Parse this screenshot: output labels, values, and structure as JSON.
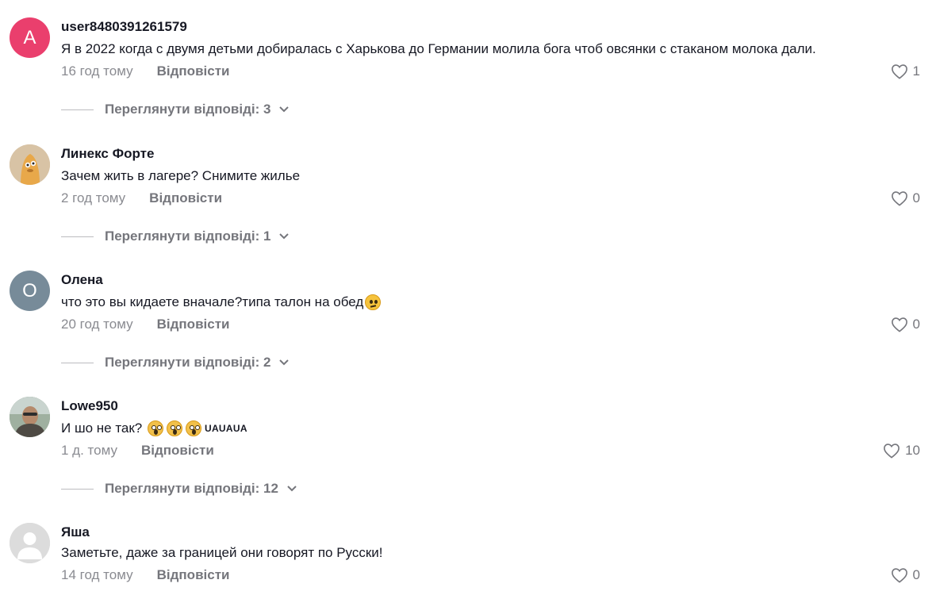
{
  "comments": [
    {
      "avatar_letter": "A",
      "avatar_color": "#ea3f6d",
      "username": "user8480391261579",
      "text": "Я в 2022 когда с двумя детьми добиралась с Харькова до Германии молила бога чтоб овсянки с стаканом молока дали.",
      "time": "16 год тому",
      "reply_label": "Відповісти",
      "likes": "1",
      "view_replies": "Переглянути відповіді: 3"
    },
    {
      "avatar_icon": "cartoon-avatar",
      "avatar_color": "#d8c3a5",
      "username": "Линекс Форте",
      "text": "Зачем жить в лагере? Снимите жилье",
      "time": "2 год тому",
      "reply_label": "Відповісти",
      "likes": "0",
      "view_replies": "Переглянути відповіді: 1"
    },
    {
      "avatar_letter": "О",
      "avatar_color": "#778b99",
      "username": "Олена",
      "text": "что это вы кидаете вначале?типа талон на обед",
      "time": "20 год тому",
      "reply_label": "Відповісти",
      "likes": "0",
      "view_replies": "Переглянути відповіді: 2"
    },
    {
      "avatar_icon": "photo-avatar",
      "avatar_color": "#7c8b7a",
      "username": "Lowe950",
      "text": "И шо не так? ",
      "text_suffix": "UAUAUA",
      "time": "1 д. тому",
      "reply_label": "Відповісти",
      "likes": "10",
      "view_replies": "Переглянути відповіді: 12"
    },
    {
      "avatar_icon": "default-avatar",
      "avatar_color": "#d9d9d9",
      "username": "Яша",
      "text": "Заметьте, даже за границей они говорят по Русски!",
      "time": "14 год тому",
      "reply_label": "Відповісти",
      "likes": "0"
    }
  ]
}
